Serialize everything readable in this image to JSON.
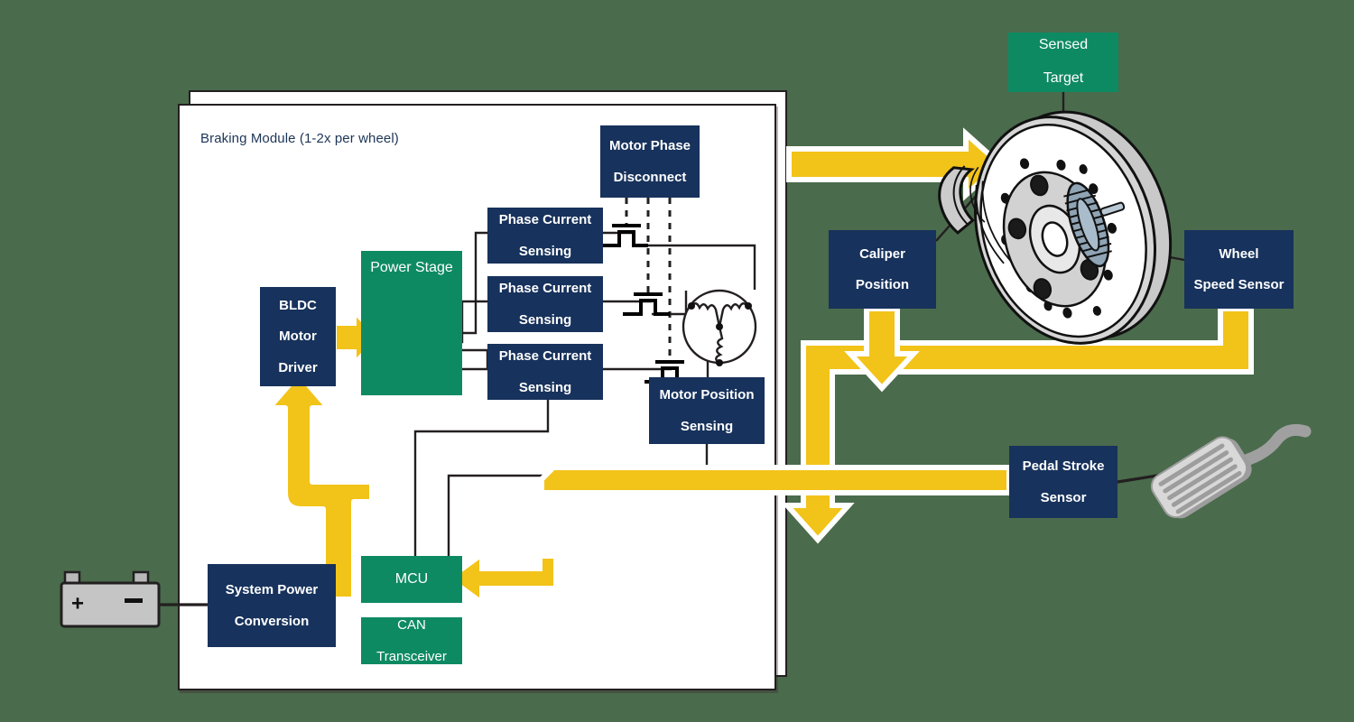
{
  "diagram": {
    "title": "Braking Module (1-2x per wheel)",
    "background_color": "#4a6b4c",
    "colors": {
      "navy": "#17325c",
      "green": "#0e8a63",
      "yellow": "#f2c319",
      "wire": "#231f20",
      "page": "#ffffff",
      "metal": "#c8c8c8"
    }
  },
  "blocks": {
    "bldc_motor_driver": "BLDC\nMotor\nDriver",
    "bldc_line1": "BLDC",
    "bldc_line2": "Motor",
    "bldc_line3": "Driver",
    "power_stage": "Power Stage",
    "phase_current_sensing_1": "Phase Current Sensing",
    "phase_current_sensing_2": "Phase Current Sensing",
    "phase_current_sensing_3": "Phase Current Sensing",
    "pcs_line1": "Phase Current",
    "pcs_line2": "Sensing",
    "motor_phase_disconnect_l1": "Motor Phase",
    "motor_phase_disconnect_l2": "Disconnect",
    "motor_position_sensing_l1": "Motor Position",
    "motor_position_sensing_l2": "Sensing",
    "mcu": "MCU",
    "can_transceiver_l1": "CAN",
    "can_transceiver_l2": "Transceiver",
    "system_power_conversion_l1": "System Power",
    "system_power_conversion_l2": "Conversion",
    "sensed_target_l1": "Sensed",
    "sensed_target_l2": "Target",
    "caliper_position_l1": "Caliper",
    "caliper_position_l2": "Position",
    "wheel_speed_sensor_l1": "Wheel",
    "wheel_speed_sensor_l2": "Speed Sensor",
    "pedal_stroke_sensor_l1": "Pedal Stroke",
    "pedal_stroke_sensor_l2": "Sensor"
  },
  "icons": {
    "battery_plus": "+",
    "battery_minus": "–"
  }
}
